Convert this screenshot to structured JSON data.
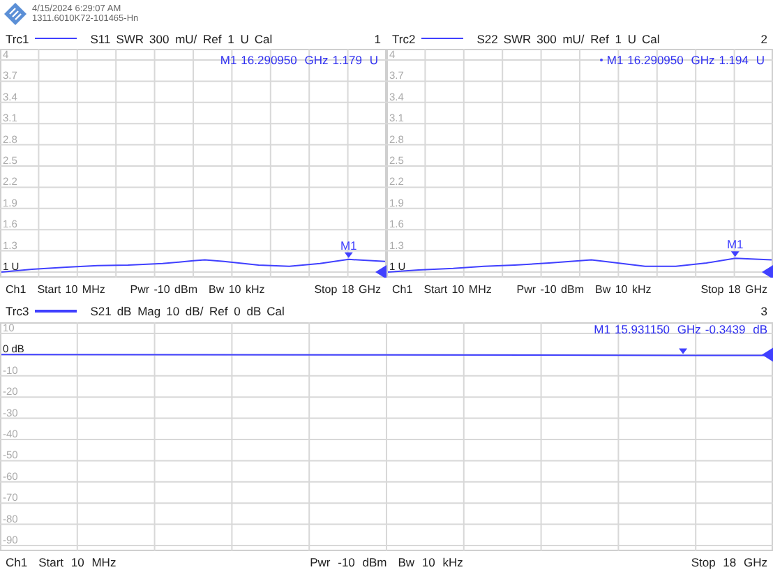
{
  "header": {
    "timestamp": "4/15/2024 6:29:07 AM",
    "instrument": "1311.6010K72-101465-Hn"
  },
  "diagrams": [
    {
      "trace": "Trc1",
      "measurement": "S11",
      "format": "SWR",
      "scale": "300 mU/ Ref 1 U",
      "cal": "Cal",
      "number": "1",
      "y_labels": [
        {
          "text": "4",
          "reference": false
        },
        {
          "text": "3.7",
          "reference": false
        },
        {
          "text": "3.4",
          "reference": false
        },
        {
          "text": "3.1",
          "reference": false
        },
        {
          "text": "2.8",
          "reference": false
        },
        {
          "text": "2.5",
          "reference": false
        },
        {
          "text": "2.2",
          "reference": false
        },
        {
          "text": "1.9",
          "reference": false
        },
        {
          "text": "1.6",
          "reference": false
        },
        {
          "text": "1.3",
          "reference": false
        },
        {
          "text": "1 U",
          "reference": true
        }
      ],
      "marker_label": "M1",
      "readout": {
        "active": false,
        "name": "M1",
        "stimulus": "16.290950 GHz",
        "response": "1.179 U"
      },
      "footer": {
        "channel": "Ch1",
        "start": "Start 10 MHz",
        "power": "Pwr -10 dBm",
        "bandwidth": "Bw 10 kHz",
        "stop": "Stop 18 GHz"
      }
    },
    {
      "trace": "Trc2",
      "measurement": "S22",
      "format": "SWR",
      "scale": "300 mU/ Ref 1 U",
      "cal": "Cal",
      "number": "2",
      "y_labels": [
        {
          "text": "4",
          "reference": false
        },
        {
          "text": "3.7",
          "reference": false
        },
        {
          "text": "3.4",
          "reference": false
        },
        {
          "text": "3.1",
          "reference": false
        },
        {
          "text": "2.8",
          "reference": false
        },
        {
          "text": "2.5",
          "reference": false
        },
        {
          "text": "2.2",
          "reference": false
        },
        {
          "text": "1.9",
          "reference": false
        },
        {
          "text": "1.6",
          "reference": false
        },
        {
          "text": "1.3",
          "reference": false
        },
        {
          "text": "1 U",
          "reference": true
        }
      ],
      "marker_label": "M1",
      "readout": {
        "active": true,
        "name": "M1",
        "stimulus": "16.290950 GHz",
        "response": "1.194 U"
      },
      "footer": {
        "channel": "Ch1",
        "start": "Start 10 MHz",
        "power": "Pwr -10 dBm",
        "bandwidth": "Bw 10 kHz",
        "stop": "Stop 18 GHz"
      }
    },
    {
      "trace": "Trc3",
      "measurement": "S21",
      "format": "dB Mag",
      "scale": "10 dB/ Ref 0 dB",
      "cal": "Cal",
      "number": "3",
      "y_labels": [
        {
          "text": "10",
          "reference": false
        },
        {
          "text": "0 dB",
          "reference": true
        },
        {
          "text": "-10",
          "reference": false
        },
        {
          "text": "-20",
          "reference": false
        },
        {
          "text": "-30",
          "reference": false
        },
        {
          "text": "-40",
          "reference": false
        },
        {
          "text": "-50",
          "reference": false
        },
        {
          "text": "-60",
          "reference": false
        },
        {
          "text": "-70",
          "reference": false
        },
        {
          "text": "-80",
          "reference": false
        },
        {
          "text": "-90",
          "reference": false
        }
      ],
      "readout": {
        "active": false,
        "name": "M1",
        "stimulus": "15.931150 GHz",
        "response": "-0.3439 dB"
      },
      "footer": {
        "channel": "Ch1",
        "start": "Start 10 MHz",
        "power": "Pwr -10 dBm",
        "bandwidth": "Bw 10 kHz",
        "stop": "Stop 18 GHz"
      }
    }
  ]
}
